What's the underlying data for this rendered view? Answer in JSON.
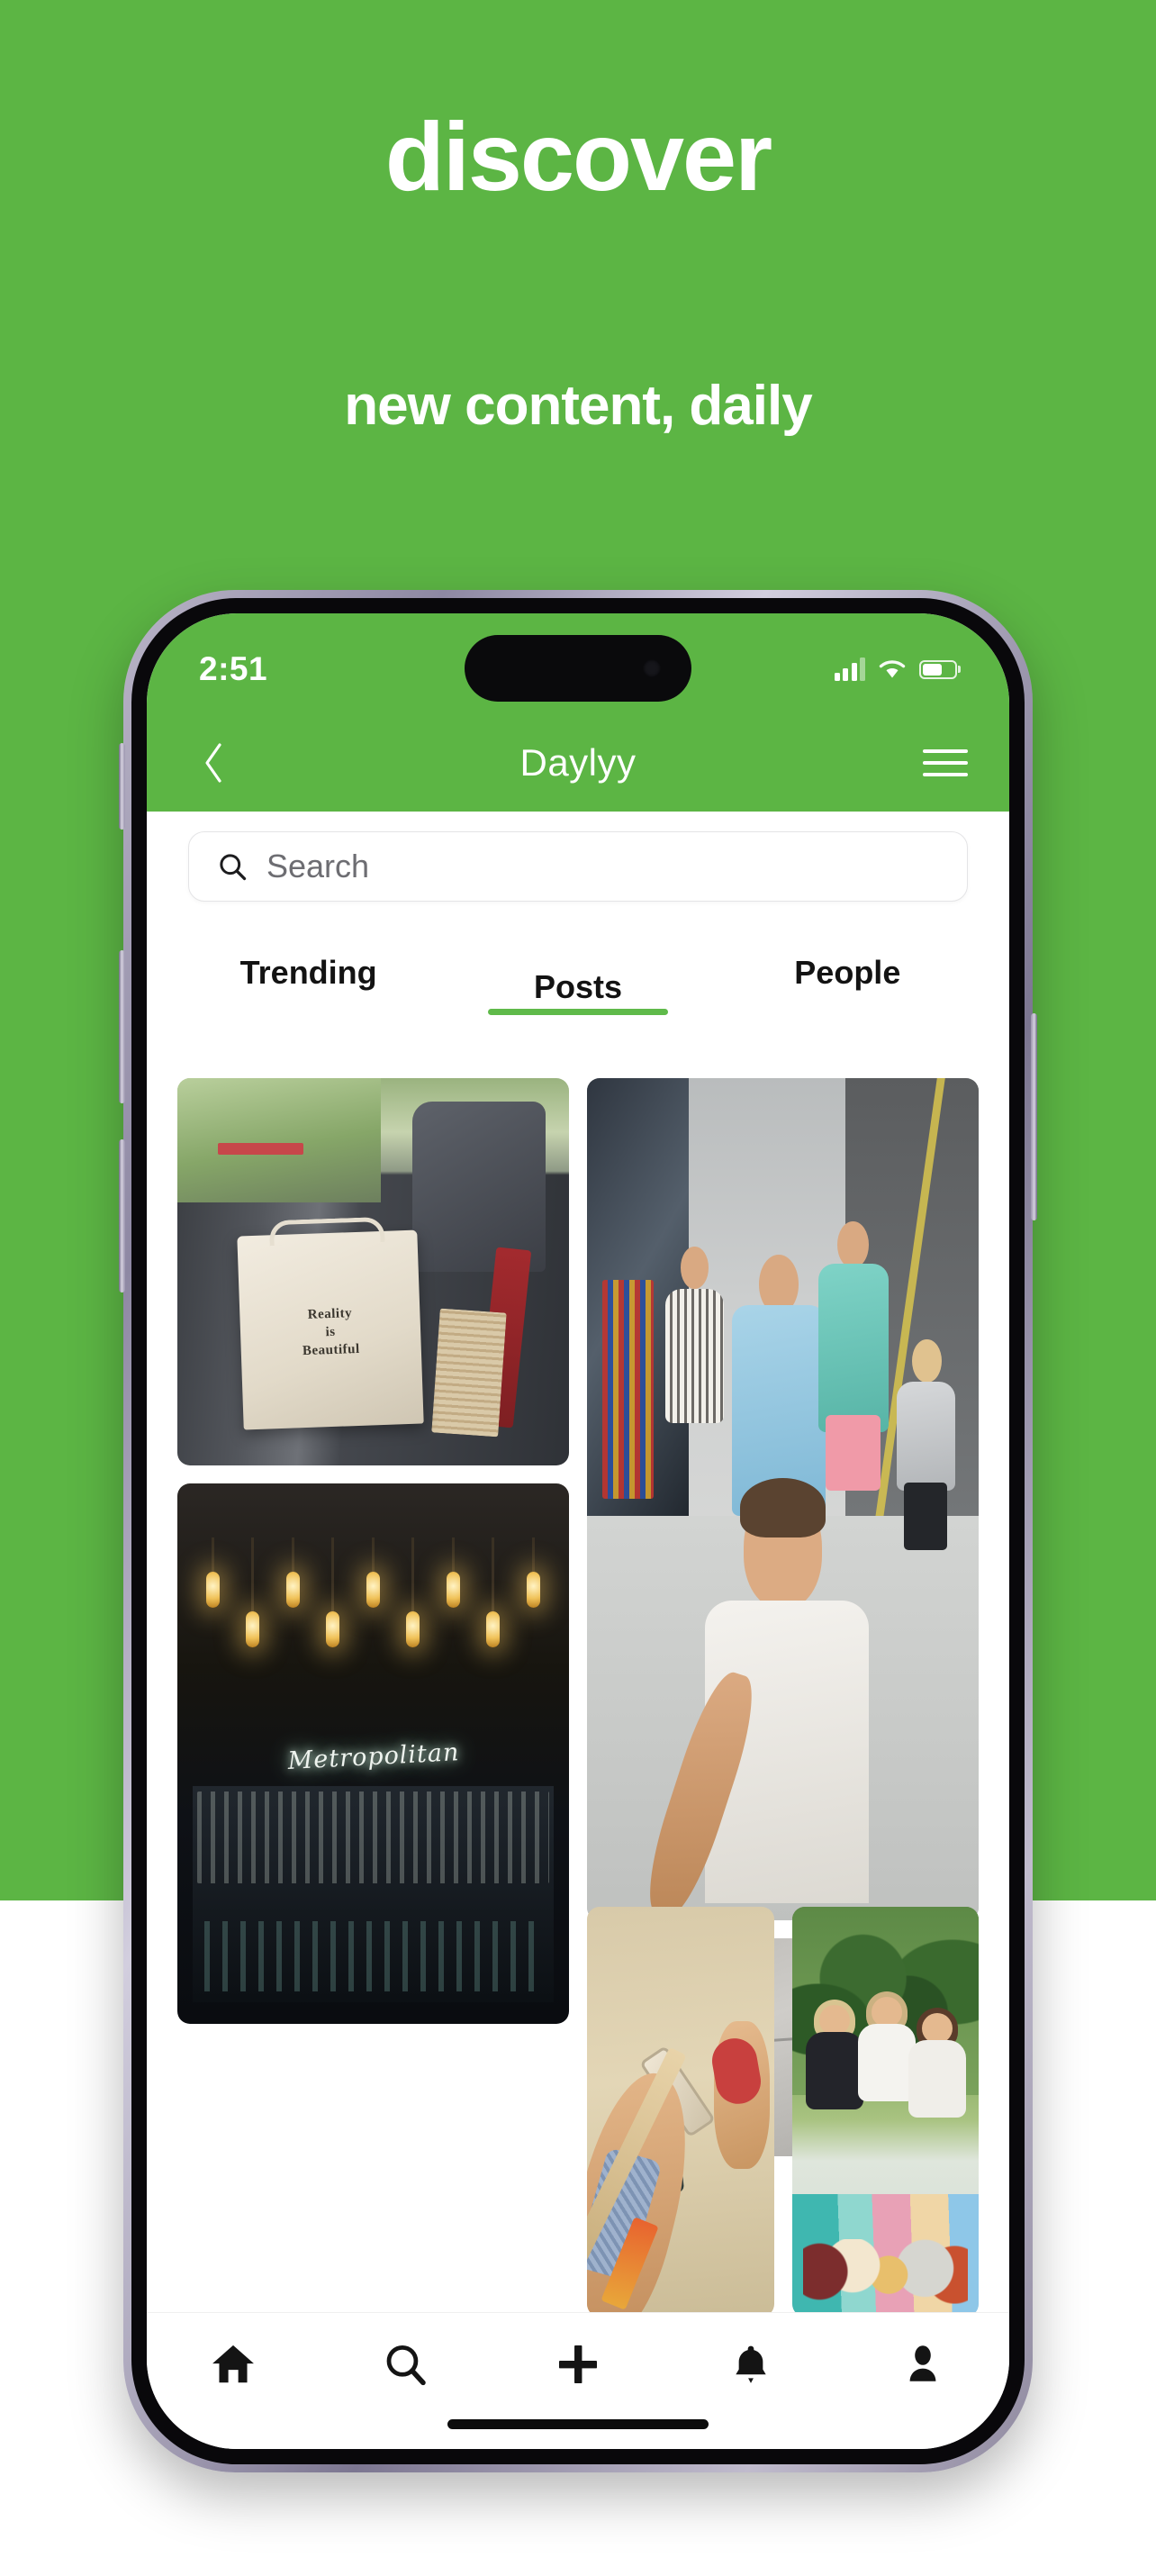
{
  "hero": {
    "headline": "discover",
    "subheadline": "new content, daily",
    "background_color": "#5cb544",
    "text_color": "#ffffff"
  },
  "phone": {
    "statusbar": {
      "time": "2:51",
      "cellular_icon": "signal-bars-icon",
      "wifi_icon": "wifi-icon",
      "battery_icon": "battery-icon",
      "battery_level": "62"
    },
    "navbar": {
      "back_icon": "chevron-left-icon",
      "title": "Daylyy",
      "menu_icon": "hamburger-menu-icon"
    },
    "search": {
      "icon": "search-icon",
      "placeholder": "Search",
      "value": ""
    },
    "tabs": [
      {
        "label": "Trending",
        "active": false
      },
      {
        "label": "Posts",
        "active": true
      },
      {
        "label": "People",
        "active": false
      }
    ],
    "active_tab_indicator_color": "#5fba4a",
    "grid": {
      "columns": [
        {
          "items": [
            {
              "name": "tote-bag-in-car-photo",
              "caption_line1": "Reality",
              "caption_line2": "is",
              "caption_line3": "Beautiful"
            },
            {
              "name": "metropolitan-bar-photo",
              "neon_sign": "Metropolitan"
            }
          ]
        },
        {
          "items": [
            {
              "name": "street-group-selfie-photo"
            },
            {
              "name": "pavement-feet-photo"
            }
          ]
        }
      ],
      "bottom_row": [
        {
          "name": "beach-selfie-photo"
        },
        {
          "name": "picnic-friends-photo"
        }
      ]
    },
    "tabbar": [
      {
        "icon": "home-icon",
        "name": "home"
      },
      {
        "icon": "search-icon",
        "name": "search"
      },
      {
        "icon": "plus-icon",
        "name": "create"
      },
      {
        "icon": "bell-icon",
        "name": "notifications"
      },
      {
        "icon": "person-icon",
        "name": "profile"
      }
    ],
    "home_indicator": "home-indicator"
  }
}
